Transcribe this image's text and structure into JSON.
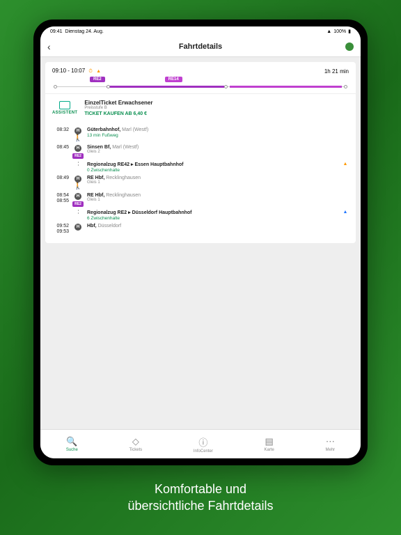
{
  "statusbar": {
    "time": "09:41",
    "date": "Dienstag 24. Aug.",
    "battery": "100%"
  },
  "header": {
    "title": "Fahrtdetails"
  },
  "summary": {
    "timerange": "09:10 - 10:07",
    "duration": "1h 21 min",
    "line1": "RE2",
    "line2": "RE14"
  },
  "ticket": {
    "assist_label": "ASSISTENT",
    "title": "EinzelTicket Erwachsener",
    "pricelevel": "Preisstufe B",
    "buy": "TICKET KAUFEN AB 6,40 €"
  },
  "journey": [
    {
      "time": "08:32",
      "type": "stop",
      "name": "Güterbahnhof,",
      "suffix": "Marl (Westf)",
      "note": "13 min Fußweg",
      "walk": true
    },
    {
      "time": "08:45",
      "type": "stop",
      "name": "Sinsen Bf,",
      "suffix": "Marl (Westf)",
      "gleis": "Gleis 2",
      "badge": "RE2"
    },
    {
      "type": "ride",
      "name": "Regionalzug RE42  ▸  Essen Hauptbahnhof",
      "stops": "0 Zwischenhalte",
      "alert": "o"
    },
    {
      "time": "08:49",
      "type": "stop",
      "name": "RE Hbf,",
      "suffix": "Recklinghausen",
      "gleis": "Gleis 1",
      "walk": true
    },
    {
      "time": "08:54",
      "time2": "08:55",
      "type": "stop",
      "name": "RE Hbf,",
      "suffix": "Recklinghausen",
      "gleis": "Gleis 1",
      "badge": "RE2"
    },
    {
      "type": "ride",
      "name": "Regionalzug RE2  ▸  Düsseldorf Hauptbahnhof",
      "stops": "6 Zwischenhalte",
      "alert": "b"
    },
    {
      "time": "09:52",
      "time2": "09:53",
      "type": "stop",
      "name": "Hbf,",
      "suffix": "Düsseldorf"
    }
  ],
  "nav": {
    "suche": "Suche",
    "tickets": "Tickets",
    "info": "InfoCenter",
    "karte": "Karte",
    "mehr": "Mehr"
  },
  "caption": {
    "l1": "Komfortable und",
    "l2": "übersichtliche Fahrtdetails"
  }
}
